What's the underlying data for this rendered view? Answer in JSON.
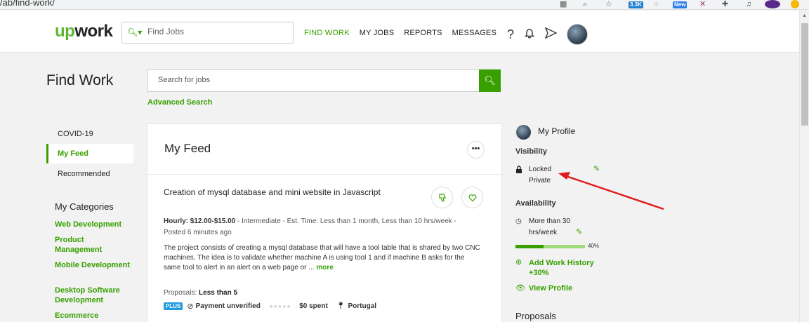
{
  "browser": {
    "url": "/ab/find-work/",
    "badges": {
      "ext1": "3.3K",
      "ext2": "New"
    }
  },
  "header": {
    "logo_green": "up",
    "logo_dark": "work",
    "search_placeholder": "Find Jobs",
    "nav": [
      "FIND WORK",
      "MY JOBS",
      "REPORTS",
      "MESSAGES"
    ],
    "icons": [
      "help-icon",
      "bell-icon",
      "send-icon"
    ]
  },
  "page": {
    "title": "Find Work",
    "search_placeholder": "Search for jobs",
    "advanced_search": "Advanced Search"
  },
  "sidebar": {
    "items": [
      "COVID-19",
      "My Feed",
      "Recommended"
    ],
    "categories_heading": "My Categories",
    "categories": [
      "Web Development",
      "Product Management",
      "Mobile Development",
      "Desktop Software Development",
      "Ecommerce"
    ]
  },
  "feed": {
    "title": "My Feed",
    "job": {
      "title": "Creation of mysql database and mini website in Javascript",
      "rate": "Hourly: $12.00-$15.00",
      "meta": " - Intermediate - Est. Time: Less than 1 month, Less than 10 hrs/week - Posted 6 minutes ago",
      "description": "The project consists of creating a mysql database that will have a tool table that is shared by two CNC machines. The idea is to validate whether machine A is using tool 1 and if machine B asks for the same tool to alert in an alert on a web page or ...",
      "more": "more",
      "proposals_label": "Proposals: ",
      "proposals_value": "Less than 5",
      "plus": "PLUS",
      "payment": "Payment unverified",
      "spent": "$0 spent",
      "location": "Portugal"
    }
  },
  "profile": {
    "title": "My Profile",
    "visibility_label": "Visibility",
    "visibility_status": "Locked",
    "visibility_sub": "Private",
    "availability_label": "Availability",
    "availability_line1": "More than 30",
    "availability_line2": "hrs/week",
    "progress_percent": 40,
    "progress_text": "40%",
    "add_history_line1": "Add Work History",
    "add_history_line2": "+30%",
    "view_profile": "View Profile",
    "proposals_heading": "Proposals"
  },
  "colors": {
    "brand_green": "#37a000",
    "annotation_red": "#e0191b",
    "plus_blue": "#1f9bde"
  }
}
